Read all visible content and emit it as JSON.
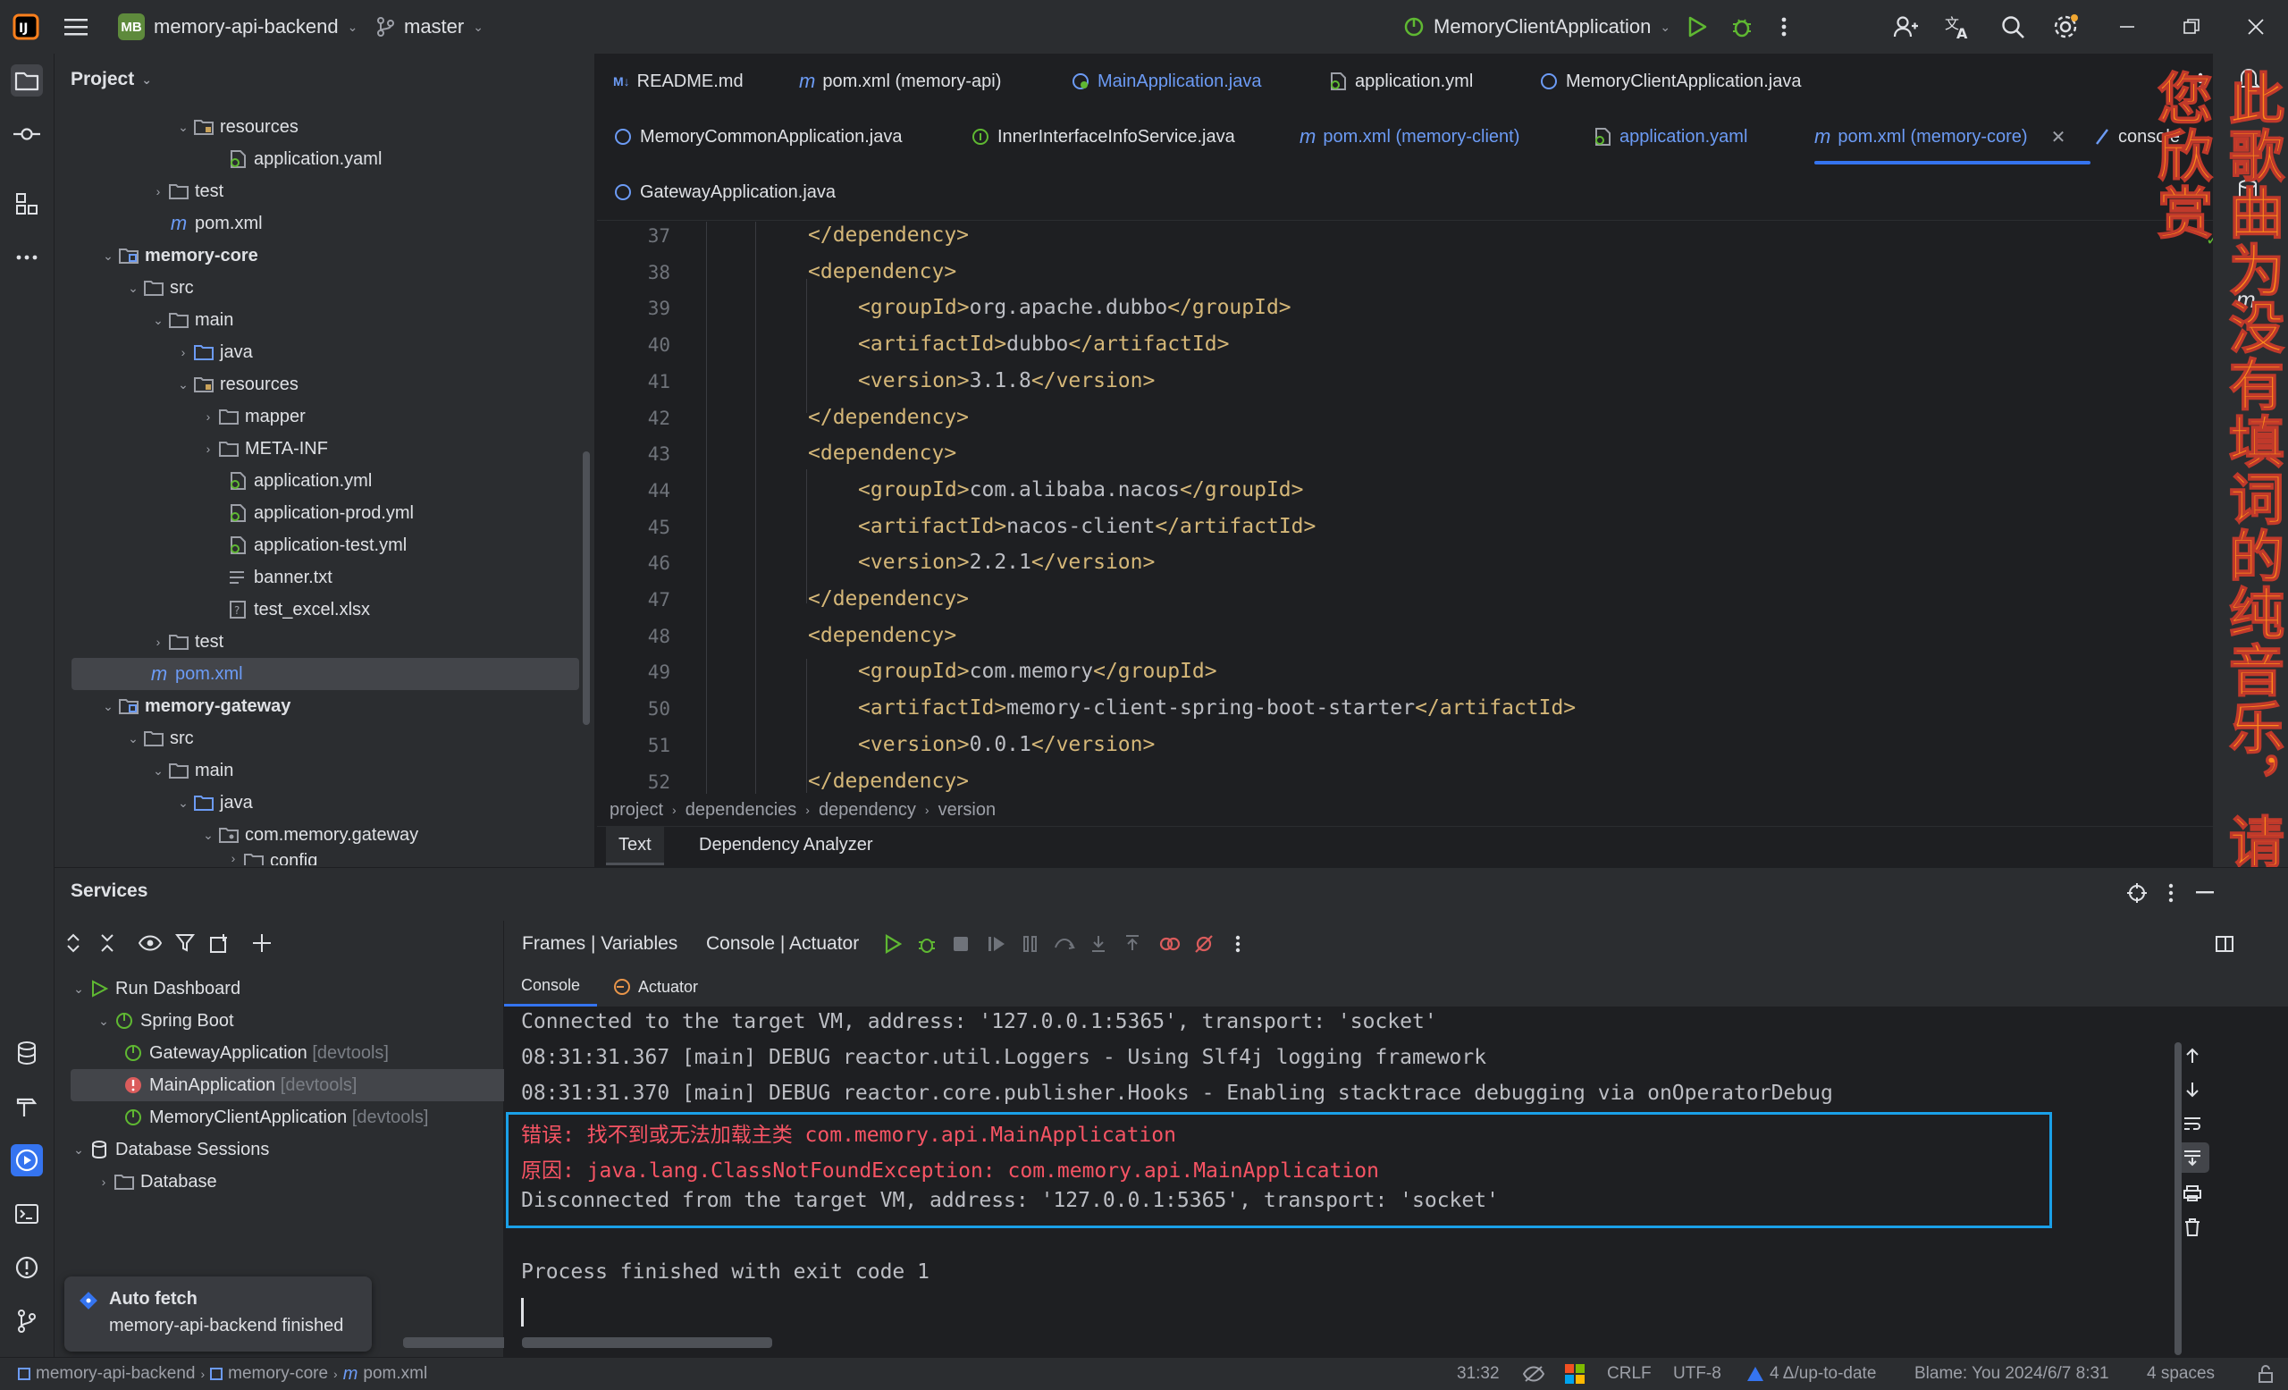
{
  "titlebar": {
    "project_initials": "MB",
    "project_name": "memory-api-backend",
    "branch": "master",
    "run_config": "MemoryClientApplication"
  },
  "project_panel": {
    "title": "Project",
    "tree": [
      {
        "label": "resources",
        "kind": "res-folder"
      },
      {
        "label": "application.yaml",
        "kind": "yaml"
      },
      {
        "label": "test",
        "kind": "folder"
      },
      {
        "label": "pom.xml",
        "kind": "maven"
      },
      {
        "label": "memory-core",
        "kind": "module"
      },
      {
        "label": "src",
        "kind": "folder"
      },
      {
        "label": "main",
        "kind": "folder"
      },
      {
        "label": "java",
        "kind": "src-folder"
      },
      {
        "label": "resources",
        "kind": "res-folder"
      },
      {
        "label": "mapper",
        "kind": "folder"
      },
      {
        "label": "META-INF",
        "kind": "folder"
      },
      {
        "label": "application.yml",
        "kind": "yaml"
      },
      {
        "label": "application-prod.yml",
        "kind": "yaml"
      },
      {
        "label": "application-test.yml",
        "kind": "yaml"
      },
      {
        "label": "banner.txt",
        "kind": "text"
      },
      {
        "label": "test_excel.xlsx",
        "kind": "unknown"
      },
      {
        "label": "test",
        "kind": "folder"
      },
      {
        "label": "pom.xml",
        "kind": "maven"
      },
      {
        "label": "memory-gateway",
        "kind": "module"
      },
      {
        "label": "src",
        "kind": "folder"
      },
      {
        "label": "main",
        "kind": "folder"
      },
      {
        "label": "java",
        "kind": "src-folder"
      },
      {
        "label": "com.memory.gateway",
        "kind": "package"
      },
      {
        "label": "config",
        "kind": "folder"
      }
    ]
  },
  "editor": {
    "tabs_row1": [
      "README.md",
      "pom.xml (memory-api)",
      "MainApplication.java",
      "application.yml",
      "MemoryClientApplication.java"
    ],
    "tabs_row2": [
      "MemoryCommonApplication.java",
      "InnerInterfaceInfoService.java",
      "pom.xml (memory-client)",
      "application.yaml",
      "pom.xml (memory-core)",
      "console"
    ],
    "tabs_row3": [
      "GatewayApplication.java"
    ],
    "lines": [
      {
        "n": "37",
        "open": "</",
        "tag": "dependency",
        "close": ">"
      },
      {
        "n": "38",
        "open": "<",
        "tag": "dependency",
        "close": ">"
      },
      {
        "n": "39",
        "tag": "groupId",
        "text": "org.apache.dubbo"
      },
      {
        "n": "40",
        "tag": "artifactId",
        "text": "dubbo"
      },
      {
        "n": "41",
        "tag": "version",
        "text": "3.1.8"
      },
      {
        "n": "42",
        "open": "</",
        "tag": "dependency",
        "close": ">"
      },
      {
        "n": "43",
        "open": "<",
        "tag": "dependency",
        "close": ">"
      },
      {
        "n": "44",
        "tag": "groupId",
        "text": "com.alibaba.nacos"
      },
      {
        "n": "45",
        "tag": "artifactId",
        "text": "nacos-client"
      },
      {
        "n": "46",
        "tag": "version",
        "text": "2.2.1"
      },
      {
        "n": "47",
        "open": "</",
        "tag": "dependency",
        "close": ">"
      },
      {
        "n": "48",
        "open": "<",
        "tag": "dependency",
        "close": ">"
      },
      {
        "n": "49",
        "tag": "groupId",
        "text": "com.memory"
      },
      {
        "n": "50",
        "tag": "artifactId",
        "text": "memory-client-spring-boot-starter"
      },
      {
        "n": "51",
        "tag": "version",
        "text": "0.0.1"
      },
      {
        "n": "52",
        "open": "</",
        "tag": "dependency",
        "close": ">"
      }
    ],
    "breadcrumb": [
      "project",
      "dependencies",
      "dependency",
      "version"
    ],
    "bottom_tabs": [
      "Text",
      "Dependency Analyzer"
    ]
  },
  "overlay_lyrics": "此歌曲为没有填词的纯音乐，请您欣赏",
  "services": {
    "title": "Services",
    "tree": [
      {
        "label": "Run Dashboard",
        "suffix": ""
      },
      {
        "label": "Spring Boot",
        "suffix": ""
      },
      {
        "label": "GatewayApplication",
        "suffix": "[devtools]"
      },
      {
        "label": "MainApplication",
        "suffix": "[devtools]"
      },
      {
        "label": "MemoryClientApplication",
        "suffix": "[devtools]"
      },
      {
        "label": "Database Sessions",
        "suffix": ""
      },
      {
        "label": "Database",
        "suffix": ""
      }
    ],
    "console_tabs": [
      "Frames | Variables",
      "Console | Actuator"
    ],
    "sub_tabs": [
      "Console",
      "Actuator"
    ],
    "console_lines": [
      "Connected to the target VM, address: '127.0.0.1:5365', transport: 'socket'",
      "08:31:31.367 [main] DEBUG reactor.util.Loggers - Using Slf4j logging framework",
      "08:31:31.370 [main] DEBUG reactor.core.publisher.Hooks - Enabling stacktrace debugging via onOperatorDebug",
      "错误: 找不到或无法加载主类 com.memory.api.MainApplication",
      "原因: java.lang.ClassNotFoundException: com.memory.api.MainApplication",
      "Disconnected from the target VM, address: '127.0.0.1:5365', transport: 'socket'",
      "Process finished with exit code 1"
    ]
  },
  "notification": {
    "title": "Auto fetch",
    "body": "memory-api-backend finished"
  },
  "statusbar": {
    "path": [
      "memory-api-backend",
      "memory-core",
      "pom.xml"
    ],
    "position": "31:32",
    "line_sep": "CRLF",
    "encoding": "UTF-8",
    "vcs": "4 Δ/up-to-date",
    "blame": "Blame: You 2024/6/7 8:31",
    "indent": "4 spaces"
  },
  "colors": {
    "accent": "#3574f0",
    "error": "#f75464",
    "tag": "#d5b778",
    "highlight_box": "#1aa0e8",
    "lyrics": "#ff8c1a"
  }
}
